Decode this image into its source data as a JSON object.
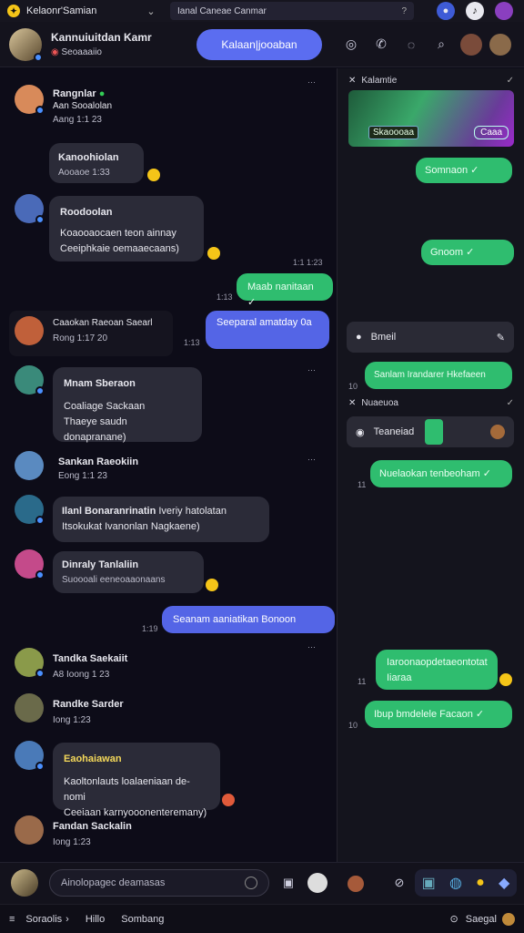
{
  "topbar": {
    "title": "Kelaonr'Samian",
    "search": "Ianal Caneae Canmar"
  },
  "header": {
    "title": "Kannuiuitdan",
    "title2": "Kamr",
    "status": "Seoaaaiio",
    "primary_button": "Kalaan|jooaban"
  },
  "messages": [
    {
      "name": "Rangnlar",
      "line2": "Aan Sooalolan",
      "meta": "Aang 1:1 23"
    },
    {
      "text": "Kanoohiolan",
      "meta": "Aooaoe 1:33"
    },
    {
      "name": "Roodoolan",
      "line1": "Koaooaocaen teon ainnay",
      "line2": "Ceeiphkaie oemaaecaans)"
    },
    {
      "text": "Maab nanitaan",
      "mine": true
    },
    {
      "name": "Caaokan Raeoan Saearl",
      "meta": "Rong 1:17 20"
    },
    {
      "text": "Seeparal amatday 0a",
      "mine": true
    },
    {
      "name": "Mnam Sberaon",
      "line1": "Coaliage Sackaan",
      "line2": "Thaeye saudn donapranane)"
    },
    {
      "name": "Sankan Raeokiin",
      "meta": "Eong 1:1 23"
    },
    {
      "name": "Ilanl Bonaranrinatin",
      "extra": "Iveriy hatolatan",
      "line2": "Itsokukat Ivanonlan Nagkaene)"
    },
    {
      "name": "Dinraly Tanlaliin",
      "meta": "Suoooali eeneoaaonaans"
    },
    {
      "text": "Seanam aaniatikan Bonoon",
      "mine": true
    },
    {
      "name": "Tandka Saekaiit",
      "meta": "A8 Ioong 1 23"
    },
    {
      "name": "Randke Sarder",
      "meta": "Iong 1:23"
    },
    {
      "name": "Eaohaiawan",
      "line1": "Kaoltonlauts loalaeniaan de-nomi",
      "line2": "Ceeiaan karnyooonenteremany)"
    },
    {
      "name": "Fandan Sackalin",
      "meta": "Iong 1:23"
    }
  ],
  "times": [
    "1:1 1:23",
    "1:13",
    "1:13",
    "1:19"
  ],
  "right": {
    "header1": "Kalamtie",
    "game_label": "Skaoooaa",
    "game_badge": "Caaa",
    "sent": [
      "Somnaon",
      "Gnoom",
      "Sanlam Irandarer Hkefaeen",
      "Nuelaokan tenbeoham",
      "Iaroonaopdetaeontotat Iiaraa",
      "Ibup bmdelele Facaon"
    ],
    "search_label": "Bmeil",
    "header2": "Nuaeuoa",
    "team_label": "Teaneiad",
    "times": [
      "10",
      "11",
      "11",
      "10"
    ]
  },
  "composer": {
    "placeholder": "Ainolopagec deamasas"
  },
  "bottombar": {
    "left": "Soraolis",
    "menu1": "Hillo",
    "menu2": "Sombang",
    "right": "Saegal"
  },
  "colors": {
    "accent": "#5b6df0",
    "green": "#2fbd6f",
    "bubble": "#2b2b38"
  }
}
